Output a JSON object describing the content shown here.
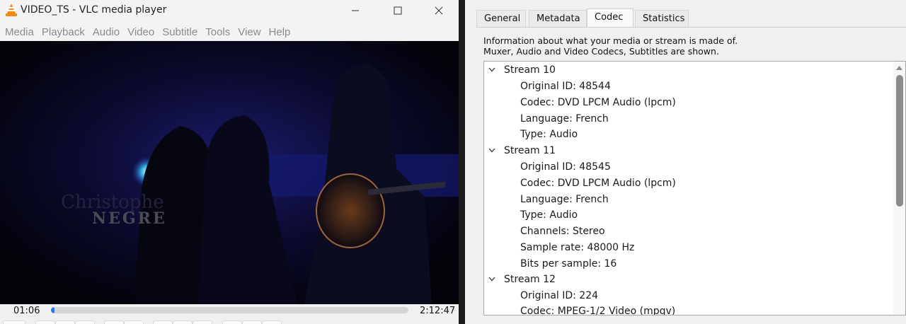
{
  "vlc": {
    "title": "VIDEO_TS - VLC media player",
    "menu": [
      "Media",
      "Playback",
      "Audio",
      "Video",
      "Subtitle",
      "Tools",
      "View",
      "Help"
    ],
    "video_overlay": {
      "line1": "Christophe",
      "line2": "NEGRE"
    },
    "time_current": "01:06",
    "time_total": "2:12:47",
    "progress_fraction": 0.008
  },
  "dialog": {
    "tabs": [
      "General",
      "Metadata",
      "Codec",
      "Statistics"
    ],
    "active_tab": "Codec",
    "description_line1": "Information about what your media or stream is made of.",
    "description_line2": "Muxer, Audio and Video Codecs, Subtitles are shown.",
    "streams": [
      {
        "label": "Stream 10",
        "props": [
          "Original ID: 48544",
          "Codec: DVD LPCM Audio (lpcm)",
          "Language: French",
          "Type: Audio"
        ]
      },
      {
        "label": "Stream 11",
        "props": [
          "Original ID: 48545",
          "Codec: DVD LPCM Audio (lpcm)",
          "Language: French",
          "Type: Audio",
          "Channels: Stereo",
          "Sample rate: 48000 Hz",
          "Bits per sample: 16"
        ]
      },
      {
        "label": "Stream 12",
        "props": [
          "Original ID: 224",
          "Codec: MPEG-1/2 Video (mpgv)"
        ]
      }
    ]
  },
  "colors": {
    "accent": "#2e7be0",
    "vlc_orange": "#f48b10"
  }
}
